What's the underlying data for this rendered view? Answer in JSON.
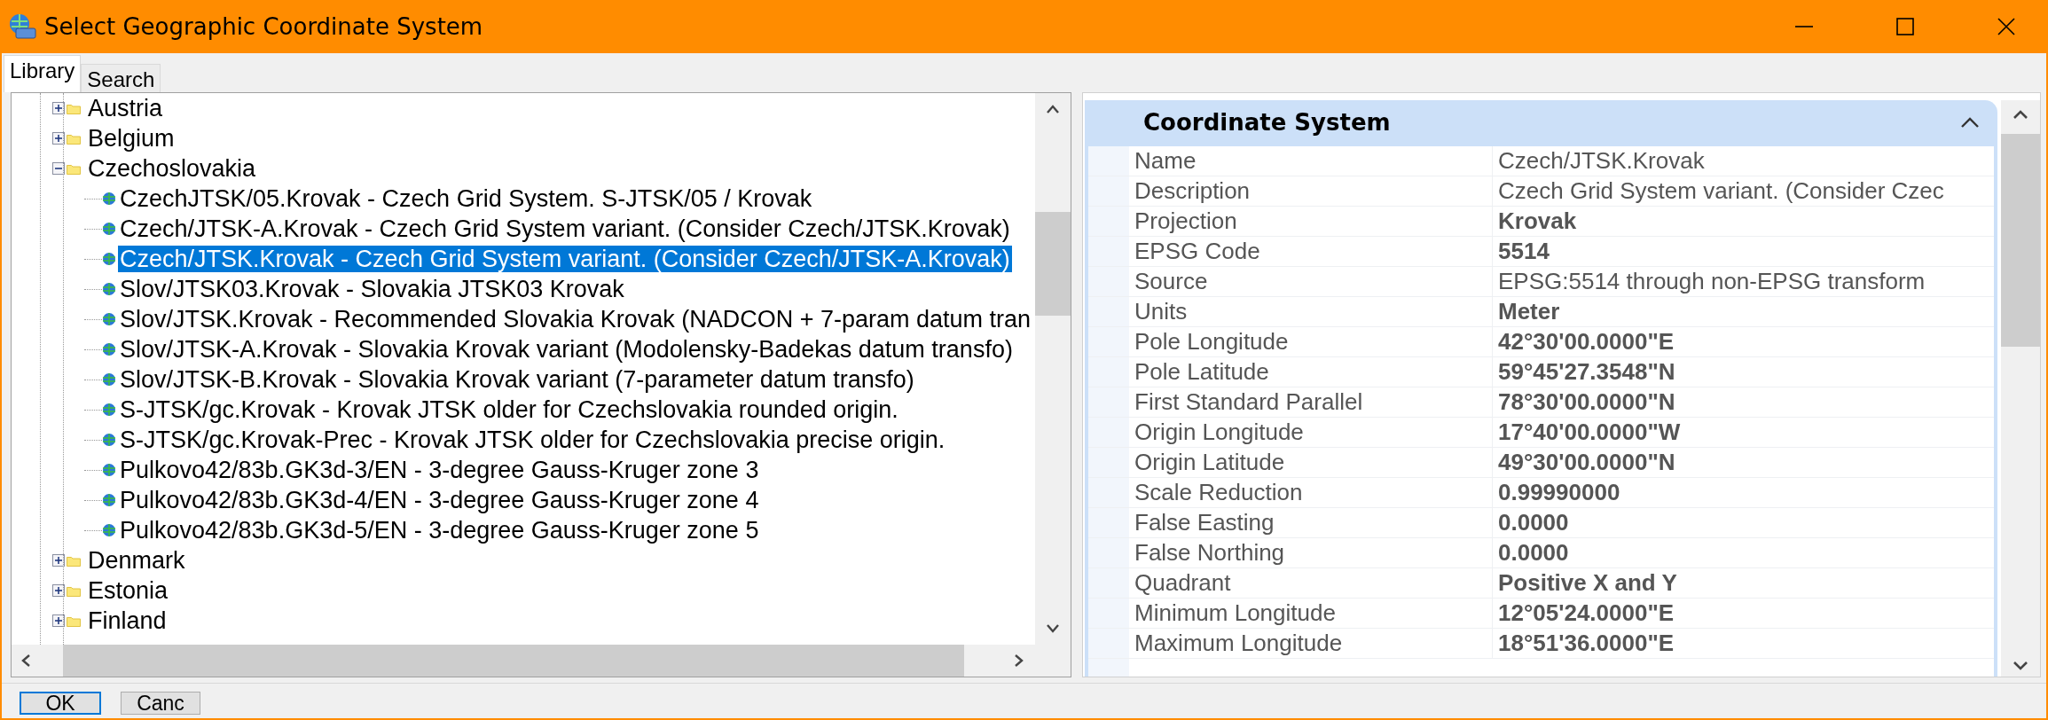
{
  "window": {
    "title": "Select Geographic Coordinate System"
  },
  "tabs": [
    {
      "label": "Library",
      "selected": true
    },
    {
      "label": "Search",
      "selected": false
    }
  ],
  "tree": {
    "items": [
      {
        "label": "Austria",
        "kind": "folder",
        "expanded": false,
        "selected": false
      },
      {
        "label": "Belgium",
        "kind": "folder",
        "expanded": false,
        "selected": false
      },
      {
        "label": "Czechoslovakia",
        "kind": "folder",
        "expanded": true,
        "selected": false,
        "children": [
          {
            "label": "CzechJTSK/05.Krovak - Czech Grid System. S-JTSK/05 / Krovak",
            "kind": "system",
            "selected": false
          },
          {
            "label": "Czech/JTSK-A.Krovak - Czech Grid System variant. (Consider Czech/JTSK.Krovak)",
            "kind": "system",
            "selected": false
          },
          {
            "label": "Czech/JTSK.Krovak - Czech Grid System variant. (Consider Czech/JTSK-A.Krovak)",
            "kind": "system",
            "selected": true
          },
          {
            "label": "Slov/JTSK03.Krovak - Slovakia JTSK03 Krovak",
            "kind": "system",
            "selected": false
          },
          {
            "label": "Slov/JTSK.Krovak - Recommended Slovakia Krovak (NADCON + 7-param datum tran",
            "kind": "system",
            "selected": false
          },
          {
            "label": "Slov/JTSK-A.Krovak - Slovakia Krovak variant (Modolensky-Badekas datum transfo)",
            "kind": "system",
            "selected": false
          },
          {
            "label": "Slov/JTSK-B.Krovak - Slovakia Krovak variant (7-parameter datum transfo)",
            "kind": "system",
            "selected": false
          },
          {
            "label": "S-JTSK/gc.Krovak - Krovak JTSK older for Czechslovakia rounded origin.",
            "kind": "system",
            "selected": false
          },
          {
            "label": "S-JTSK/gc.Krovak-Prec - Krovak JTSK older for Czechslovakia precise origin.",
            "kind": "system",
            "selected": false
          },
          {
            "label": "Pulkovo42/83b.GK3d-3/EN - 3-degree Gauss-Kruger zone 3",
            "kind": "system",
            "selected": false
          },
          {
            "label": "Pulkovo42/83b.GK3d-4/EN - 3-degree Gauss-Kruger zone 4",
            "kind": "system",
            "selected": false
          },
          {
            "label": "Pulkovo42/83b.GK3d-5/EN - 3-degree Gauss-Kruger zone 5",
            "kind": "system",
            "selected": false
          }
        ]
      },
      {
        "label": "Denmark",
        "kind": "folder",
        "expanded": false,
        "selected": false
      },
      {
        "label": "Estonia",
        "kind": "folder",
        "expanded": false,
        "selected": false
      },
      {
        "label": "Finland",
        "kind": "folder",
        "expanded": false,
        "selected": false
      }
    ]
  },
  "properties": {
    "title": "Coordinate System",
    "expanded": true,
    "rows": [
      {
        "name": "Name",
        "value": "Czech/JTSK.Krovak",
        "bold": false
      },
      {
        "name": "Description",
        "value": "Czech Grid System variant. (Consider Czec",
        "bold": false
      },
      {
        "name": "Projection",
        "value": "Krovak",
        "bold": true
      },
      {
        "name": "EPSG Code",
        "value": "5514",
        "bold": true
      },
      {
        "name": "Source",
        "value": "EPSG:5514 through non-EPSG transform",
        "bold": false
      },
      {
        "name": "Units",
        "value": "Meter",
        "bold": true
      },
      {
        "name": "Pole Longitude",
        "value": "42°30'00.0000\"E",
        "bold": true
      },
      {
        "name": "Pole Latitude",
        "value": "59°45'27.3548\"N",
        "bold": true
      },
      {
        "name": "First Standard Parallel",
        "value": "78°30'00.0000\"N",
        "bold": true
      },
      {
        "name": "Origin Longitude",
        "value": "17°40'00.0000\"W",
        "bold": true
      },
      {
        "name": "Origin Latitude",
        "value": "49°30'00.0000\"N",
        "bold": true
      },
      {
        "name": "Scale Reduction",
        "value": "0.99990000",
        "bold": true
      },
      {
        "name": "False Easting",
        "value": "0.0000",
        "bold": true
      },
      {
        "name": "False Northing",
        "value": "0.0000",
        "bold": true
      },
      {
        "name": "Quadrant",
        "value": "Positive X and Y",
        "bold": true
      },
      {
        "name": "Minimum Longitude",
        "value": "12°05'24.0000\"E",
        "bold": true
      },
      {
        "name": "Maximum Longitude",
        "value": "18°51'36.0000\"E",
        "bold": true
      }
    ]
  },
  "buttons": [
    {
      "label": "OK",
      "default": true
    },
    {
      "label": "Canc",
      "default": false
    }
  ]
}
